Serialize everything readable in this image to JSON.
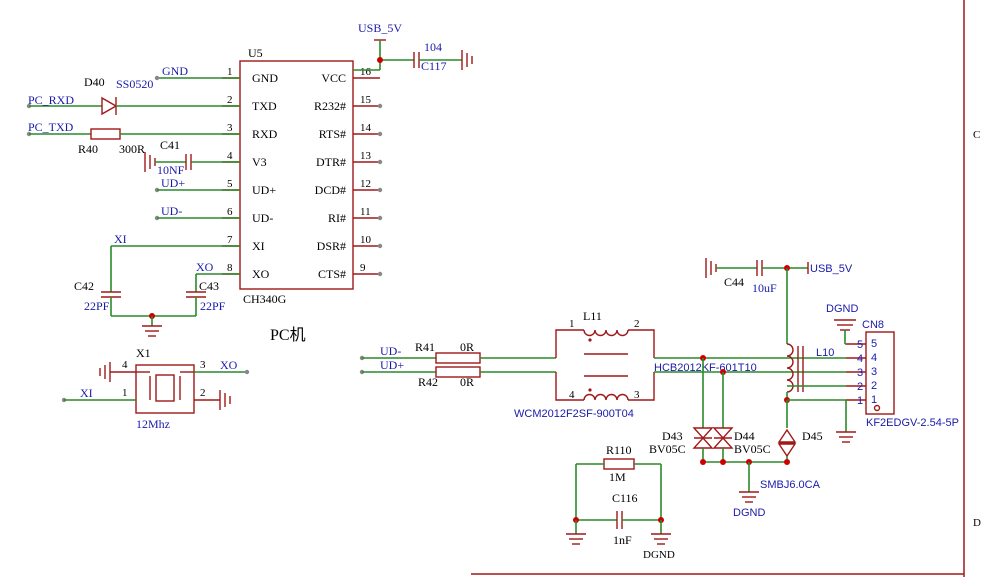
{
  "u5": {
    "ref": "U5",
    "part": "CH340G",
    "left_pins": [
      {
        "num": "1",
        "name": "GND"
      },
      {
        "num": "2",
        "name": "TXD"
      },
      {
        "num": "3",
        "name": "RXD"
      },
      {
        "num": "4",
        "name": "V3"
      },
      {
        "num": "5",
        "name": "UD+"
      },
      {
        "num": "6",
        "name": "UD-"
      },
      {
        "num": "7",
        "name": "XI"
      },
      {
        "num": "8",
        "name": "XO"
      }
    ],
    "right_pins": [
      {
        "num": "16",
        "name": "VCC"
      },
      {
        "num": "15",
        "name": "R232#"
      },
      {
        "num": "14",
        "name": "RTS#"
      },
      {
        "num": "13",
        "name": "DTR#"
      },
      {
        "num": "12",
        "name": "DCD#"
      },
      {
        "num": "11",
        "name": "RI#"
      },
      {
        "num": "10",
        "name": "DSR#"
      },
      {
        "num": "9",
        "name": "CTS#"
      }
    ]
  },
  "nets": {
    "usb5v_top": "USB_5V",
    "gnd": "GND",
    "pc_rxd": "PC_RXD",
    "pc_txd": "PC_TXD",
    "udp_left": "UD+",
    "udm_left": "UD-",
    "xi_top": "XI",
    "xo_top": "XO",
    "xo_osc": "XO",
    "xi_osc": "XI",
    "udm_right": "UD-",
    "udp_right": "UD+",
    "usb5v_right": "USB_5V",
    "dgnd_top": "DGND",
    "dgnd_bottom": "DGND",
    "dgnd_left": "DGND"
  },
  "components": {
    "c117": {
      "ref": "C117",
      "value": "104"
    },
    "d40": {
      "ref": "D40",
      "value": "SS0520"
    },
    "r40": {
      "ref": "R40",
      "value": "300R"
    },
    "c41": {
      "ref": "C41",
      "value": "10NF"
    },
    "c42": {
      "ref": "C42",
      "value": "22PF"
    },
    "c43": {
      "ref": "C43",
      "value": "22PF"
    },
    "x1": {
      "ref": "X1",
      "value": "12Mhz",
      "pins": [
        "4",
        "3",
        "1",
        "2"
      ]
    },
    "r41": {
      "ref": "R41",
      "value": "0R"
    },
    "r42": {
      "ref": "R42",
      "value": "0R"
    },
    "l11": {
      "ref": "L11",
      "value": "WCM2012F2SF-900T04",
      "pins": [
        "1",
        "2",
        "4",
        "3"
      ]
    },
    "l10": {
      "ref": "L10",
      "value": "HCB2012KF-601T10"
    },
    "c44": {
      "ref": "C44",
      "value": "10uF"
    },
    "d43": {
      "ref": "D43",
      "value": "BV05C"
    },
    "d44": {
      "ref": "D44",
      "value": "BV05C"
    },
    "d45": {
      "ref": "D45",
      "value": "SMBJ6.0CA"
    },
    "r110": {
      "ref": "R110",
      "value": "1M"
    },
    "c116": {
      "ref": "C116",
      "value": "1nF"
    },
    "cn8": {
      "ref": "CN8",
      "value": "KF2EDGV-2.54-5P",
      "pins": [
        "5",
        "4",
        "3",
        "2",
        "1"
      ]
    }
  },
  "section_title": "PC机",
  "border_labels": {
    "c": "C",
    "d": "D"
  }
}
